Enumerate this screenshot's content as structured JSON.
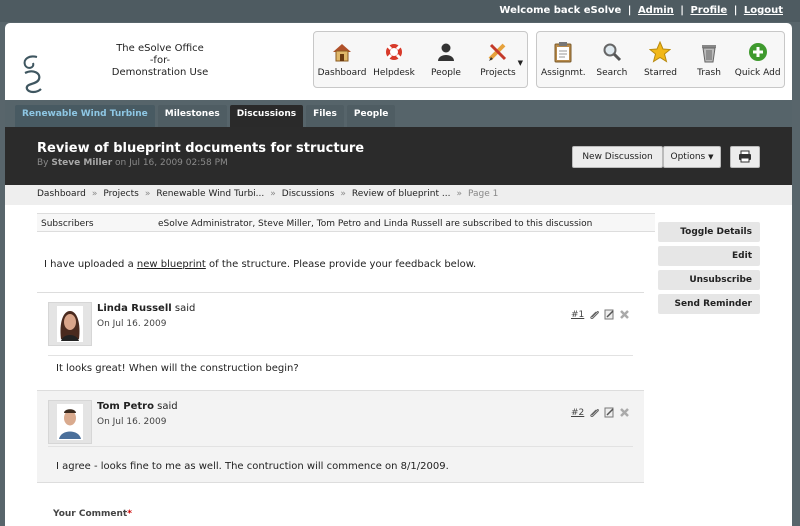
{
  "topbar": {
    "welcome": "Welcome back eSolve",
    "admin": "Admin",
    "profile": "Profile",
    "logout": "Logout"
  },
  "brand": {
    "line1": "The eSolve Office",
    "line2": "-for-",
    "line3": "Demonstration Use"
  },
  "nav_primary": [
    {
      "label": "Dashboard",
      "icon": "house-icon"
    },
    {
      "label": "Helpdesk",
      "icon": "lifebuoy-icon"
    },
    {
      "label": "People",
      "icon": "person-icon"
    },
    {
      "label": "Projects",
      "icon": "pencil-ruler-icon"
    }
  ],
  "nav_secondary": [
    {
      "label": "Assignmt.",
      "icon": "clipboard-icon"
    },
    {
      "label": "Search",
      "icon": "magnifier-icon"
    },
    {
      "label": "Starred",
      "icon": "star-icon"
    },
    {
      "label": "Trash",
      "icon": "trash-icon"
    },
    {
      "label": "Quick Add",
      "icon": "plus-circle-icon"
    }
  ],
  "tabs": [
    {
      "label": "Renewable Wind Turbine"
    },
    {
      "label": "Milestones"
    },
    {
      "label": "Discussions"
    },
    {
      "label": "Files"
    },
    {
      "label": "People"
    }
  ],
  "discussion": {
    "title": "Review of blueprint documents for structure",
    "by": "By",
    "author": "Steve Miller",
    "on": "on",
    "date": "Jul 16, 2009 02:58 PM"
  },
  "buttons": {
    "new_discussion": "New Discussion",
    "options": "Options",
    "print_icon": "printer-icon"
  },
  "breadcrumb": [
    "Dashboard",
    "Projects",
    "Renewable Wind Turbi...",
    "Discussions",
    "Review of blueprint ...",
    "Page 1"
  ],
  "subscribers": {
    "label": "Subscribers",
    "text": "eSolve Administrator, Steve Miller, Tom Petro and Linda Russell are subscribed to this discussion"
  },
  "intro": {
    "before": "I have uploaded a ",
    "link": "new blueprint",
    "after": " of the structure.  Please provide your feedback below."
  },
  "comments": [
    {
      "name": "Linda Russell",
      "said": "said",
      "date": "On Jul 16. 2009",
      "num": "#1",
      "body": "It looks great!  When will the construction begin?"
    },
    {
      "name": "Tom Petro",
      "said": "said",
      "date": "On Jul 16. 2009",
      "num": "#2",
      "body": "I agree - looks fine to me as well.  The contruction will commence on 8/1/2009."
    }
  ],
  "side_buttons": [
    "Toggle Details",
    "Edit",
    "Unsubscribe",
    "Send Reminder"
  ],
  "comment_form": {
    "label": "Your Comment",
    "required": "*"
  }
}
